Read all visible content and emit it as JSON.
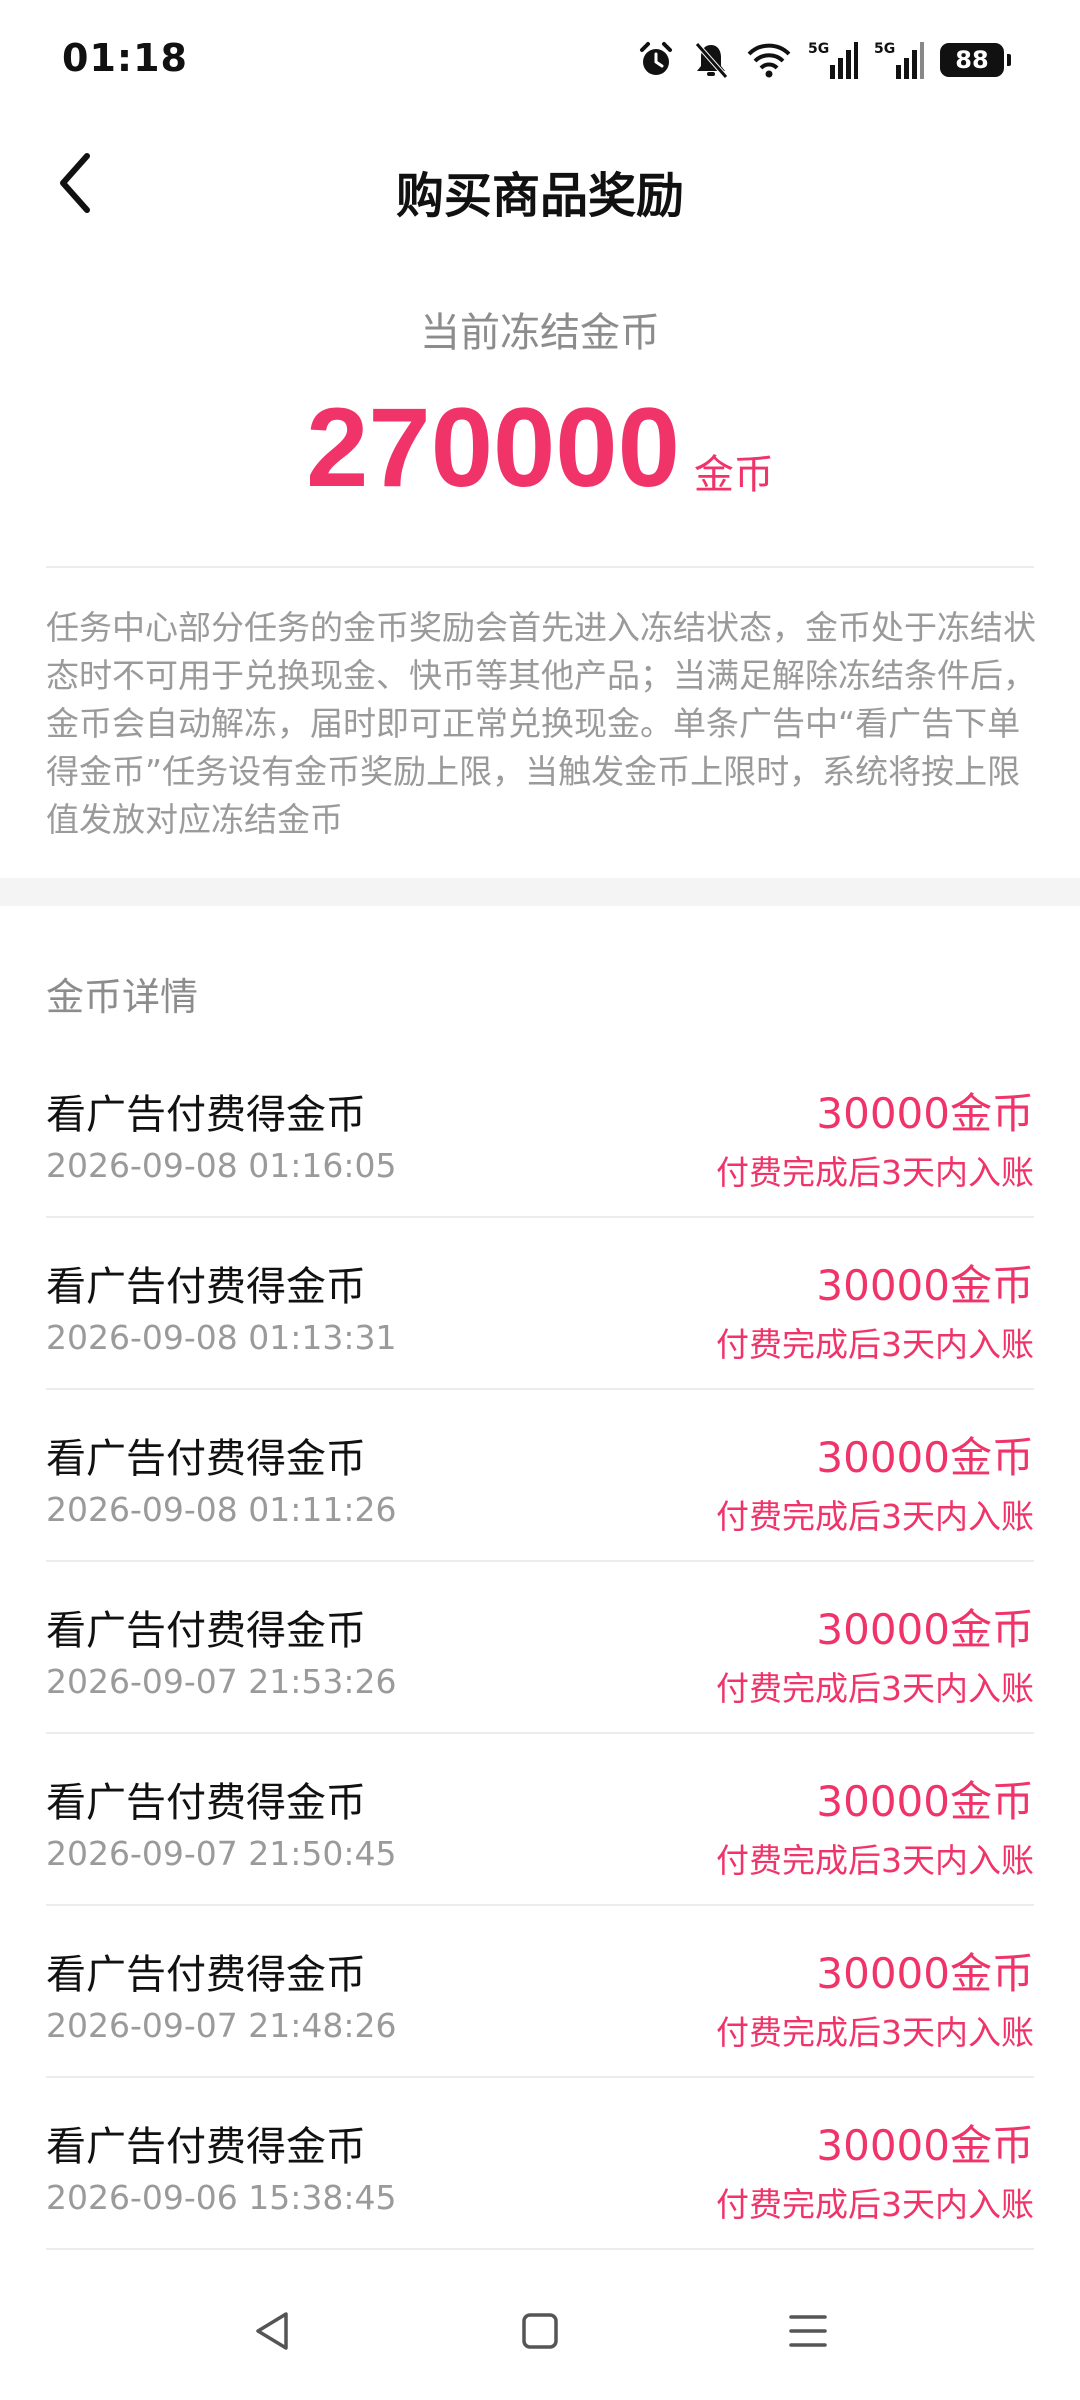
{
  "status_bar": {
    "time": "01:18",
    "battery": "88",
    "icons": [
      "alarm-icon",
      "bell-off-icon",
      "wifi-icon",
      "signal-5g-icon",
      "signal-5g-icon"
    ]
  },
  "header": {
    "title": "购买商品奖励",
    "back_icon": "chevron-left-icon"
  },
  "summary": {
    "label": "当前冻结金币",
    "value": "270000",
    "unit": "金币"
  },
  "description": "任务中心部分任务的金币奖励会首先进入冻结状态，金币处于冻结状态时不可用于兑换现金、快币等其他产品；当满足解除冻结条件后，金币会自动解冻，届时即可正常兑换现金。单条广告中“看广告下单得金币”任务设有金币奖励上限，当触发金币上限时，系统将按上限值发放对应冻结金币",
  "details": {
    "title": "金币详情",
    "items": [
      {
        "title": "看广告付费得金币",
        "time": "2026-09-08 01:16:05",
        "amount": "30000金币",
        "note": "付费完成后3天内入账"
      },
      {
        "title": "看广告付费得金币",
        "time": "2026-09-08 01:13:31",
        "amount": "30000金币",
        "note": "付费完成后3天内入账"
      },
      {
        "title": "看广告付费得金币",
        "time": "2026-09-08 01:11:26",
        "amount": "30000金币",
        "note": "付费完成后3天内入账"
      },
      {
        "title": "看广告付费得金币",
        "time": "2026-09-07 21:53:26",
        "amount": "30000金币",
        "note": "付费完成后3天内入账"
      },
      {
        "title": "看广告付费得金币",
        "time": "2026-09-07 21:50:45",
        "amount": "30000金币",
        "note": "付费完成后3天内入账"
      },
      {
        "title": "看广告付费得金币",
        "time": "2026-09-07 21:48:26",
        "amount": "30000金币",
        "note": "付费完成后3天内入账"
      },
      {
        "title": "看广告付费得金币",
        "time": "2026-09-06 15:38:45",
        "amount": "30000金币",
        "note": "付费完成后3天内入账"
      }
    ]
  },
  "nav_bar": {
    "icons": [
      "back-triangle-icon",
      "home-square-icon",
      "menu-lines-icon"
    ]
  },
  "colors": {
    "accent": "#f0346a",
    "muted_text": "#9a9a9a",
    "divider": "#ececec",
    "section_gap": "#f4f4f4"
  }
}
